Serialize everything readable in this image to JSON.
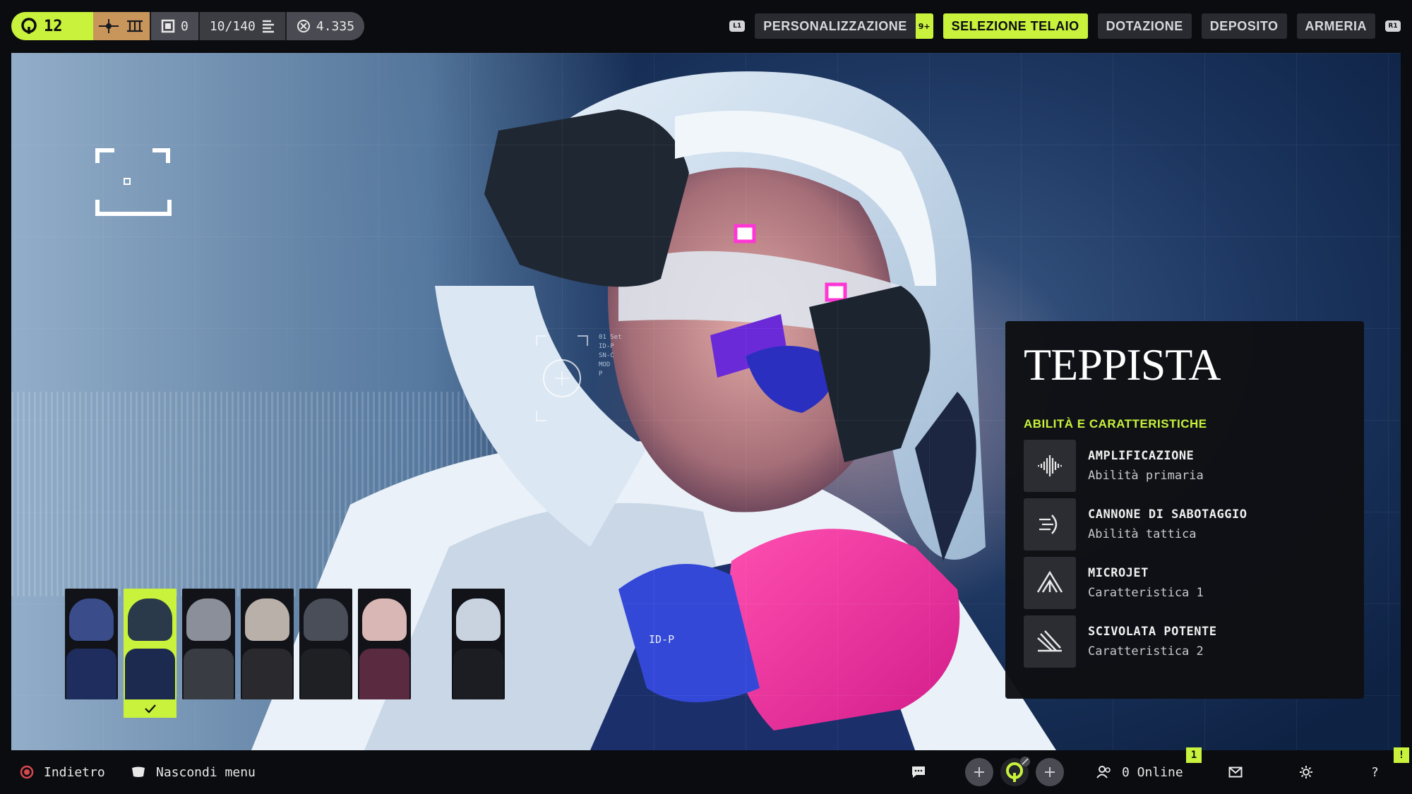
{
  "topbar": {
    "level": "12",
    "slots_value": "0",
    "capacity": "10/140",
    "currency": "4.335",
    "left_bumper": "L1",
    "right_bumper": "R1",
    "tabs": [
      {
        "label": "PERSONALIZZAZIONE",
        "badge": "9+",
        "active": false
      },
      {
        "label": "SELEZIONE TELAIO",
        "active": true
      },
      {
        "label": "DOTAZIONE",
        "active": false
      },
      {
        "label": "DEPOSITO",
        "active": false
      },
      {
        "label": "ARMERIA",
        "active": false
      }
    ]
  },
  "scene": {
    "id_tag": "ID-P",
    "crosshair_text": "01 Set\nID-P\nSN-C\nMOD\nP"
  },
  "info_panel": {
    "title": "TEPPISTA",
    "subtitle": "ABILITÀ E CARATTERISTICHE",
    "abilities": [
      {
        "name": "AMPLIFICAZIONE",
        "type": "Abilità primaria",
        "icon": "sound-wave-icon"
      },
      {
        "name": "CANNONE DI SABOTAGGIO",
        "type": "Abilità tattica",
        "icon": "sabotage-cannon-icon"
      },
      {
        "name": "MICROJET",
        "type": "Caratteristica 1",
        "icon": "microjet-icon"
      },
      {
        "name": "SCIVOLATA POTENTE",
        "type": "Caratteristica 2",
        "icon": "power-slide-icon"
      }
    ]
  },
  "roster": {
    "selected_index": 1,
    "portraits": [
      {
        "face": "#3a4c8a",
        "body": "#1f2c5e"
      },
      {
        "face": "#2b3a4a",
        "body": "#1d2a50"
      },
      {
        "face": "#8a8f99",
        "body": "#3a3c44"
      },
      {
        "face": "#b9b0aa",
        "body": "#2a2a2e"
      },
      {
        "face": "#4a4e58",
        "body": "#1e2024"
      },
      {
        "face": "#d9b7b4",
        "body": "#5a2a40"
      },
      {
        "face": "#c9d3e0",
        "body": "#1c1d22"
      }
    ]
  },
  "bottombar": {
    "back_label": "Indietro",
    "hide_menu_label": "Nascondi menu",
    "online_label": "0 Online",
    "online_badge": "1",
    "help_badge": "!",
    "help_label": "?"
  },
  "colors": {
    "accent": "#c8f23c",
    "panel": "#0e0f13",
    "bar": "#0b0c10"
  }
}
